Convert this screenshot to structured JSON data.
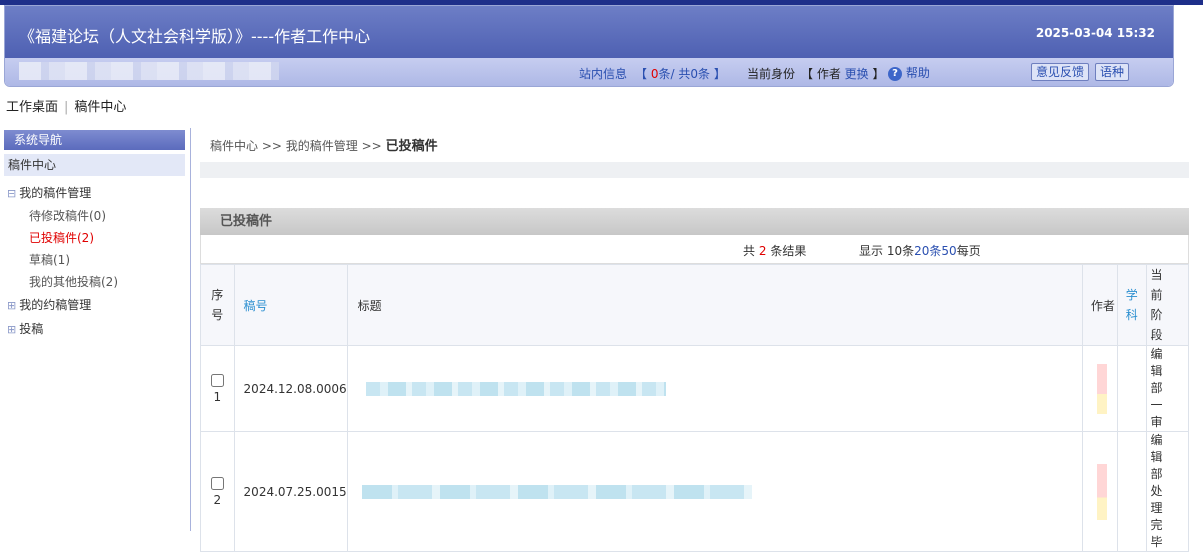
{
  "header": {
    "title": "《福建论坛（人文社会科学版）》----作者工作中心",
    "datetime": "2025-03-04 15:32",
    "site_msg": "站内信息",
    "msg_unread": "0",
    "msg_unit": "条",
    "msg_total": "/ 共0条",
    "identity_label": "当前身份",
    "identity_role": "作者",
    "switch_label": "更换",
    "help_label": "帮助",
    "feedback_label": "意见反馈",
    "lang_label": "语种"
  },
  "topnav": {
    "desk": "工作桌面",
    "center": "稿件中心"
  },
  "sidebar": {
    "title": "系统导航",
    "section": "稿件中心",
    "groups": [
      {
        "label": "我的稿件管理",
        "toggle": "⊟"
      },
      {
        "label": "我的约稿管理",
        "toggle": "⊞"
      },
      {
        "label": "投稿",
        "toggle": "⊞"
      }
    ],
    "items": [
      {
        "label": "待修改稿件(0)"
      },
      {
        "label": "已投稿件(2)",
        "color": "#e00000"
      },
      {
        "label": "草稿(1)"
      },
      {
        "label": "我的其他投稿(2)"
      }
    ]
  },
  "breadcrumb": {
    "a": "稿件中心",
    "b": "我的稿件管理",
    "sep": ">>",
    "current": "已投稿件"
  },
  "panel": {
    "title": "已投稿件"
  },
  "results": {
    "total_prefix": "共",
    "total": "2",
    "total_suffix": "条结果",
    "show_label": "显示",
    "size1": "10条",
    "size2": "20条",
    "size3": "50",
    "size_suffix": "每页"
  },
  "table": {
    "headers": {
      "index": "序号",
      "number": "稿号",
      "title": "标题",
      "author": "作者",
      "subject": "学科",
      "stage": "当前阶段"
    },
    "rows": [
      {
        "index": "1",
        "number": "2024.12.08.0006",
        "stage": "编辑部一审"
      },
      {
        "index": "2",
        "number": "2024.07.25.0015",
        "stage": "编辑部处理完毕"
      }
    ]
  }
}
